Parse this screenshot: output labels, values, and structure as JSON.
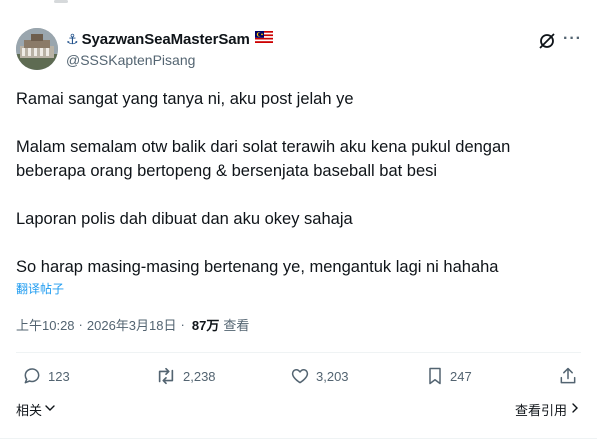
{
  "author": {
    "anchor_emoji": "⚓",
    "display_name": "SyazwanSeaMasterSam",
    "flag_emoji": "🇲🇾",
    "handle": "@SSSKaptenPisang"
  },
  "tweet": {
    "lines": [
      "Ramai sangat yang tanya ni, aku post jelah ye",
      "",
      "Malam semalam otw balik dari solat terawih aku kena pukul dengan",
      "beberapa orang bertopeng & bersenjata baseball bat besi",
      "",
      "Laporan polis dah dibuat dan aku okey sahaja",
      "",
      "So harap masing-masing bertenang ye, mengantuk lagi ni hahaha"
    ],
    "translate_label": "翻译帖子"
  },
  "meta": {
    "time": "上午10:28",
    "separator": "·",
    "date": "2026年3月18日",
    "views_count": "87万",
    "views_label": "查看"
  },
  "actions": {
    "replies": "123",
    "reposts": "2,238",
    "likes": "3,203",
    "bookmarks": "247"
  },
  "footer": {
    "related_label": "相关",
    "quotes_label": "查看引用"
  },
  "colors": {
    "text": "#0f1419",
    "secondary": "#536471",
    "link": "#1d9bf0",
    "divider": "#eff3f4"
  }
}
